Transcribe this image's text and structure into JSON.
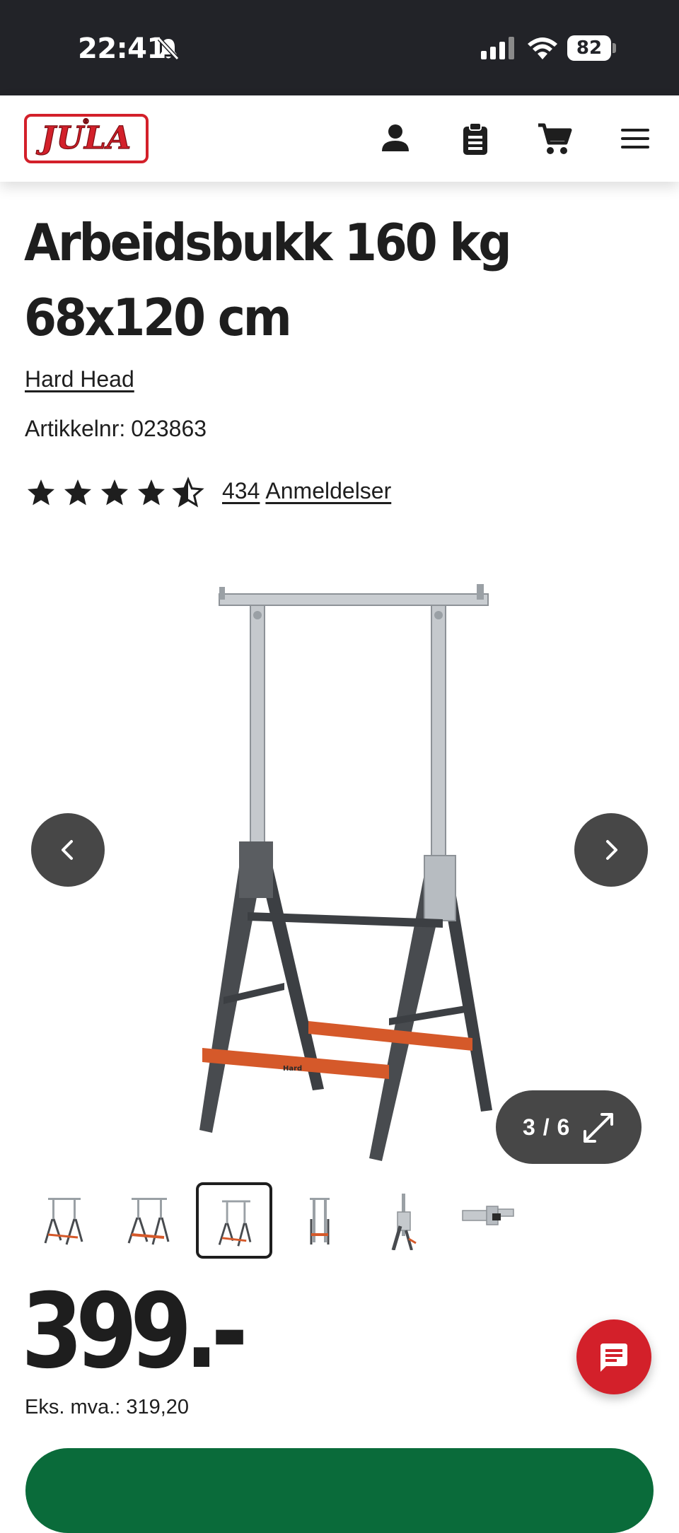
{
  "status_bar": {
    "time": "22:41",
    "battery": "82"
  },
  "header": {
    "logo_text": "JULA"
  },
  "product": {
    "title": "Arbeidsbukk 160 kg 68x120 cm",
    "brand": "Hard Head",
    "sku_label": "Artikkelnr:",
    "sku": "023863",
    "rating": 4.5,
    "review_count": "434",
    "review_label": "Anmeldelser"
  },
  "gallery": {
    "counter": "3 / 6",
    "active_index": 2,
    "thumb_count": 6
  },
  "pricing": {
    "price": "399.-",
    "ex_vat_label": "Eks. mva.:",
    "ex_vat_value": "319,20"
  },
  "colors": {
    "brand_red": "#d3202a",
    "header_dark": "#222328",
    "buy_green": "#0a6b3a",
    "control_gray": "#474747",
    "accent_orange": "#d5592a"
  },
  "icons": [
    "bell-off-icon",
    "signal-icon",
    "wifi-icon",
    "battery-icon",
    "user-icon",
    "clipboard-icon",
    "cart-icon",
    "menu-icon",
    "chevron-left-icon",
    "chevron-right-icon",
    "expand-icon",
    "chat-icon",
    "star-icon",
    "star-half-icon"
  ]
}
